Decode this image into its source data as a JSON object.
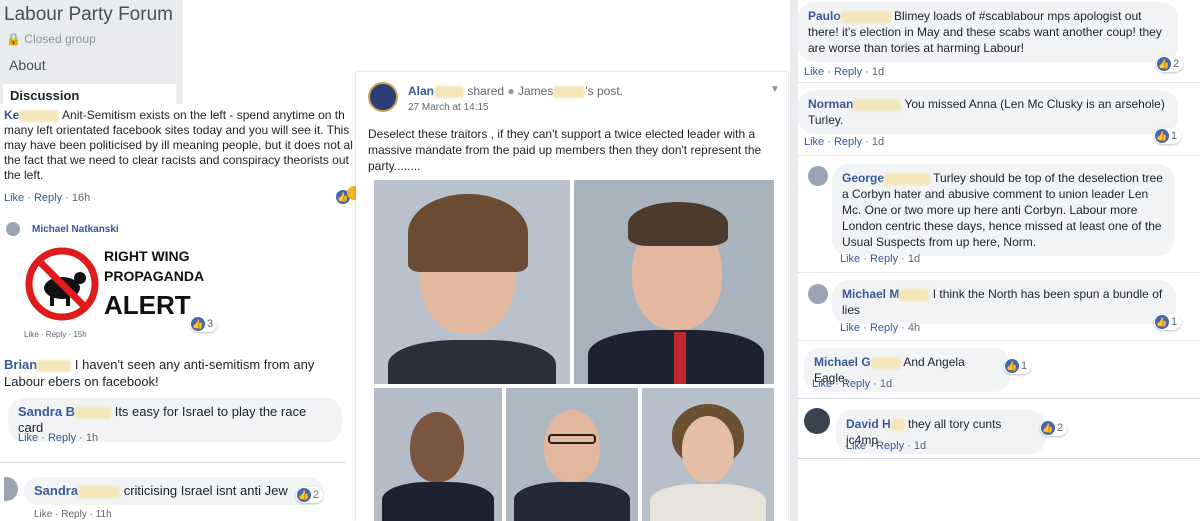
{
  "group": {
    "title": "Labour Party Forum",
    "privacy": "Closed group",
    "nav_about": "About",
    "nav_discussion": "Discussion"
  },
  "left_post": {
    "author": "Ke",
    "text": "Anit-Semitism exists on the left - spend anytime on th many left orientated facebook sites today and you will see it. This may have been politicised by ill meaning people, but it does not al the fact that we need to clear racists and conspiracy theorists out the left.",
    "like": "Like",
    "reply": "Reply",
    "age": "16h"
  },
  "meme_comment": {
    "author": "Michael Natkanski",
    "meme_line1": "RIGHT WING",
    "meme_line2": "PROPAGANDA",
    "meme_line3": "ALERT",
    "meta": "Like · Reply · 15h",
    "count": "3"
  },
  "brian_comment": {
    "author": "Brian",
    "text": "I haven't seen any anti-semitism from any Labour ebers on facebook!"
  },
  "sandra1": {
    "author": "Sandra B",
    "text": "Its easy for Israel to play the race card",
    "like": "Like",
    "reply": "Reply",
    "age": "1h"
  },
  "sandra2": {
    "author": "Sandra",
    "text": "criticising Israel isnt anti Jew",
    "meta": "Like · Reply · 11h",
    "count": "2"
  },
  "center_post": {
    "author": "Alan",
    "shared_text": "shared",
    "shared_by": "James",
    "shared_suffix": "'s post.",
    "time": "27 March at 14:15",
    "text": "Deselect these traitors , if they can't support a twice elected leader with a massive mandate from the paid up members then they don't represent the party........"
  },
  "right_comments": [
    {
      "author": "Paulo",
      "text": "Blimey loads of #scablabour mps apologist out there! it's election in May and these scabs want another coup! they are worse than tories at harming Labour!",
      "like": "Like",
      "reply": "Reply",
      "age": "1d",
      "count": "2"
    },
    {
      "author": "Norman",
      "text": "You missed Anna (Len Mc Clusky is an arsehole) Turley.",
      "like": "Like",
      "reply": "Reply",
      "age": "1d",
      "count": "1"
    },
    {
      "author": "George",
      "text": "Turley should be top of the deselection tree a Corbyn hater and abusive comment to union leader Len Mc. One or two more up here anti Corbyn. Labour more London centric these days, hence missed at least one of the Usual Suspects from up here, Norm.",
      "like": "Like",
      "reply": "Reply",
      "age": "1d"
    },
    {
      "author": "Michael M",
      "text": "I think the North has been spun a bundle of lies",
      "like": "Like",
      "reply": "Reply",
      "age": "4h",
      "count": "1"
    },
    {
      "author": "Michael G",
      "text": "And Angela Eagle.",
      "like": "Like",
      "reply": "Reply",
      "age": "1d",
      "count": "1"
    },
    {
      "author": "David H",
      "text": "they all tory cunts jc4mp",
      "like": "Like",
      "reply": "Reply",
      "age": "1d",
      "count": "2"
    }
  ],
  "colors": {
    "link": "#385898",
    "bubble": "#f2f3f5",
    "sidebar": "#e9ebee",
    "like_blue": "#4267b2"
  }
}
